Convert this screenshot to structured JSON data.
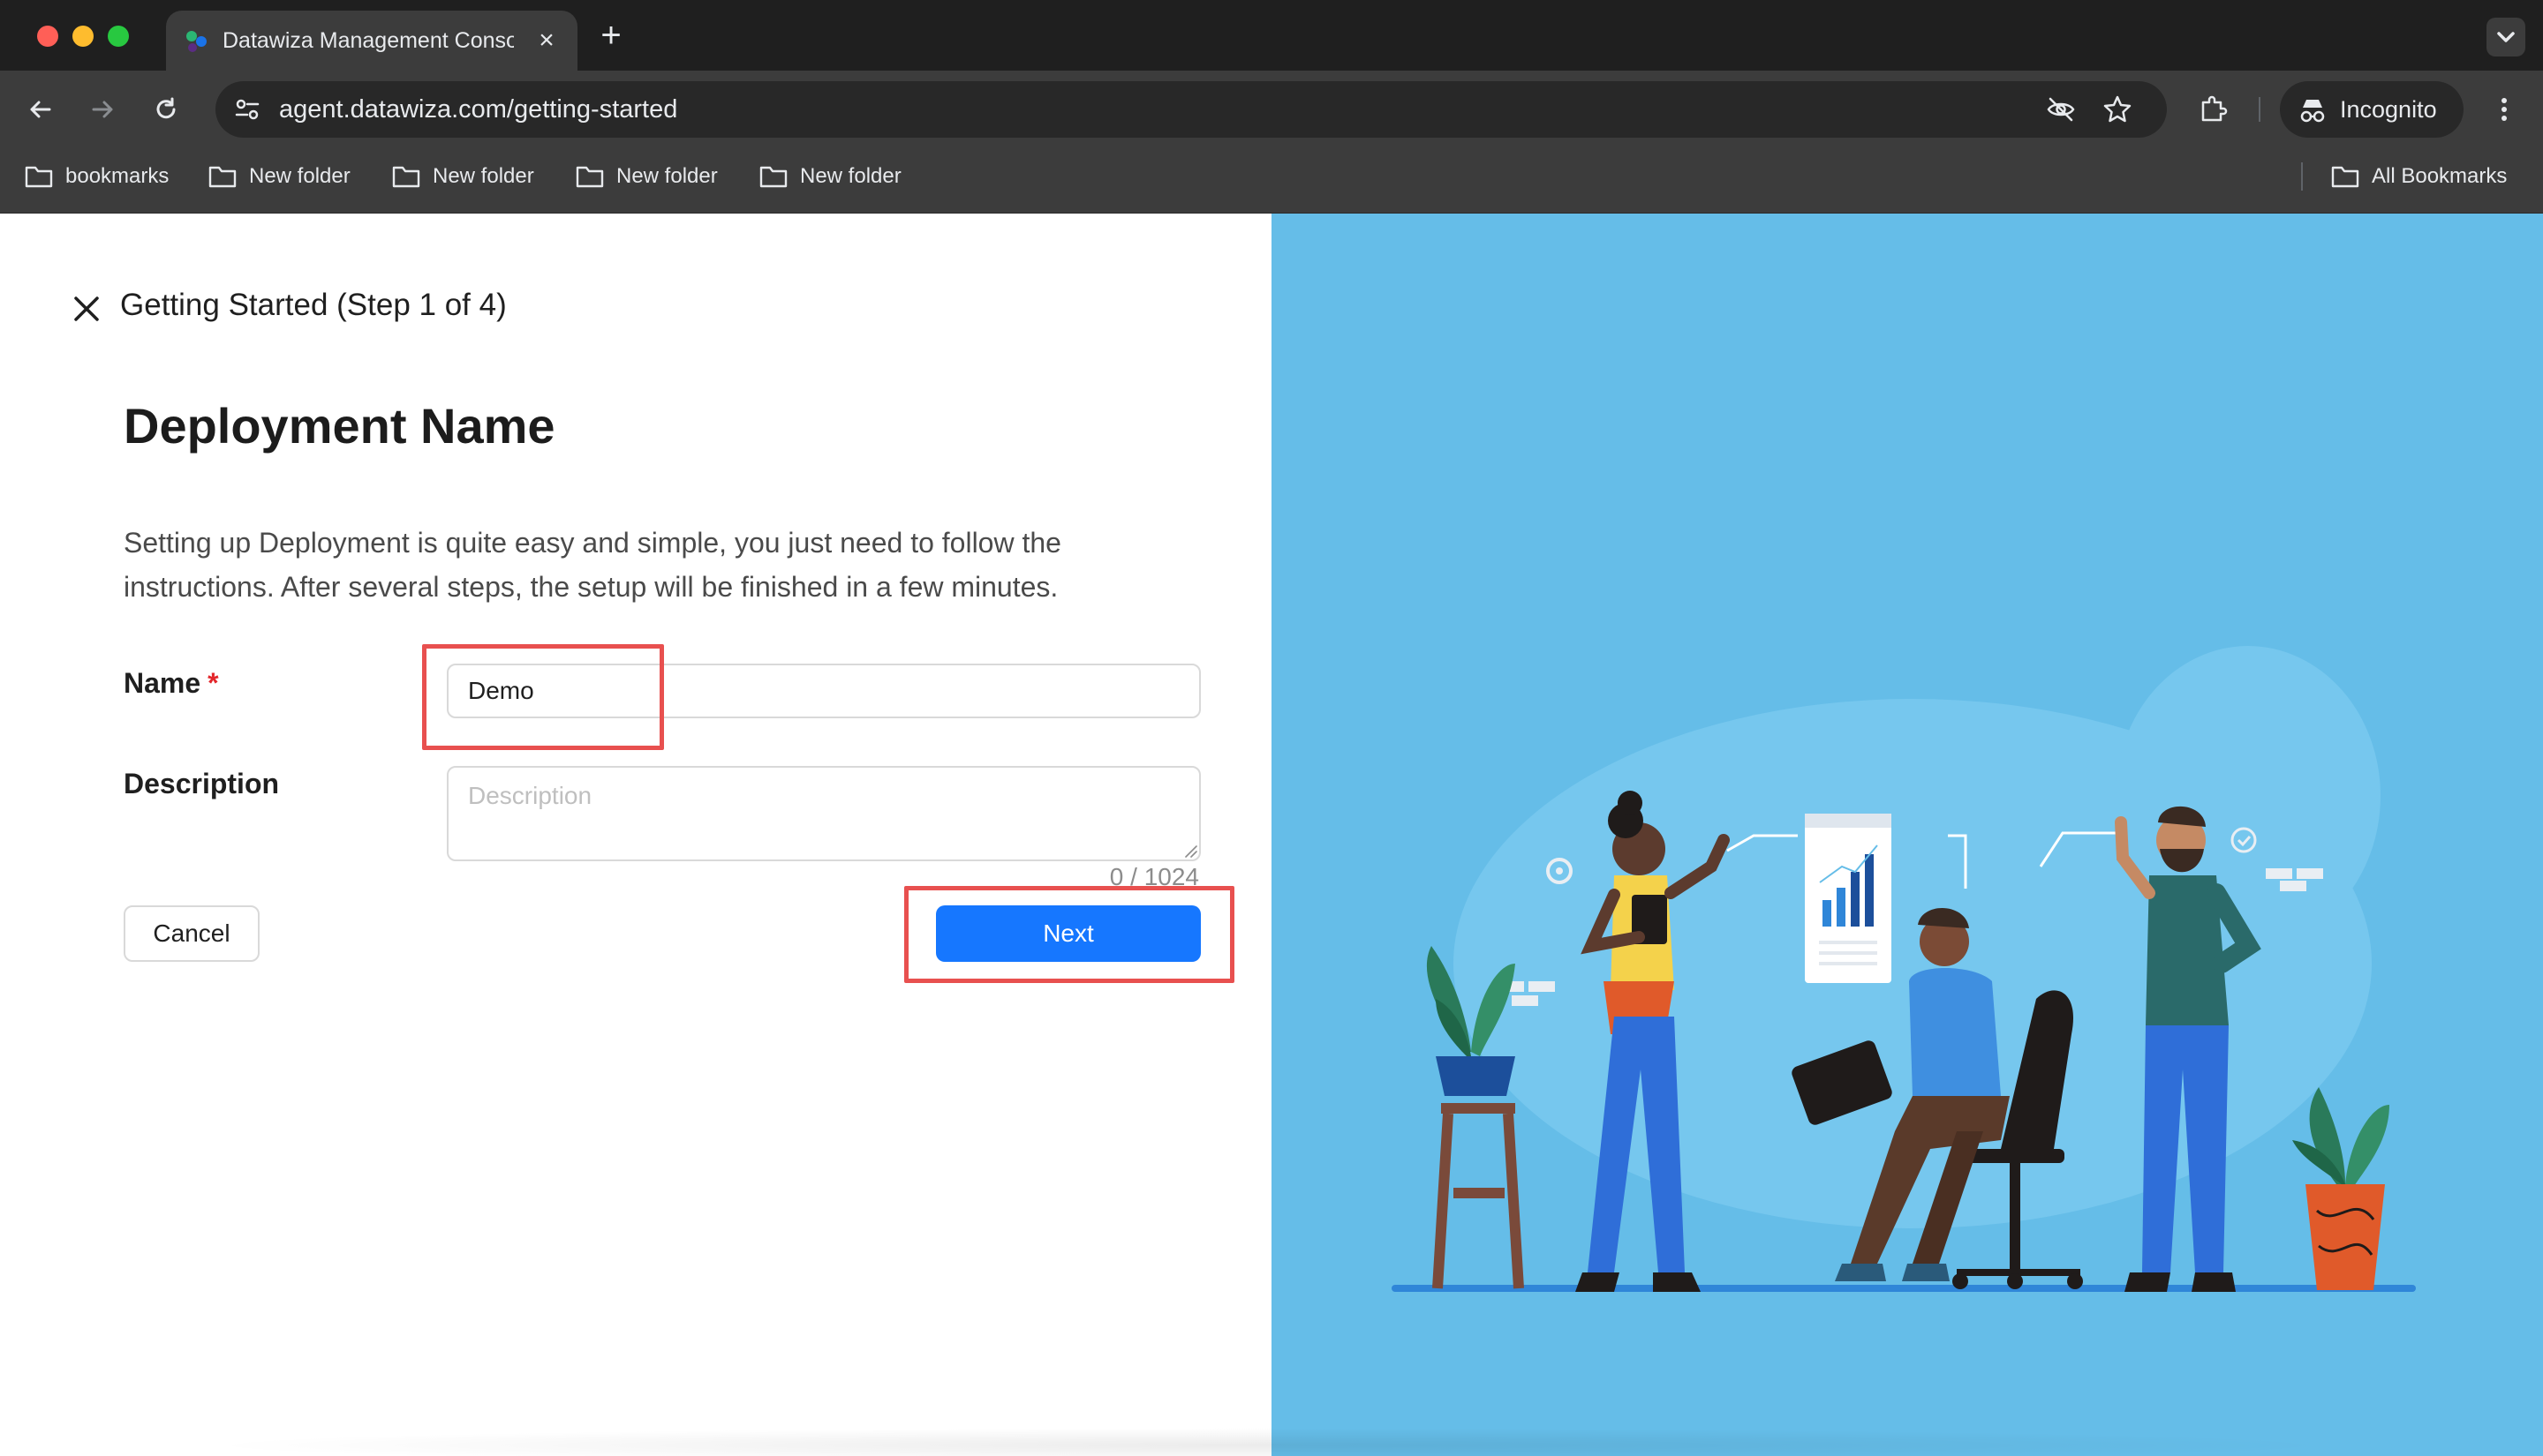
{
  "browser": {
    "tab_title": "Datawiza Management Conso",
    "url": "agent.datawiza.com/getting-started",
    "profile_label": "Incognito",
    "bookmarks": [
      "bookmarks",
      "New folder",
      "New folder",
      "New folder",
      "New folder"
    ],
    "all_bookmarks_label": "All Bookmarks"
  },
  "wizard": {
    "title": "Getting Started (Step 1 of 4)",
    "heading": "Deployment Name",
    "intro": "Setting up Deployment is quite easy and simple, you just need to follow the instructions. After several steps, the setup will be finished in a few minutes.",
    "name_label": "Name",
    "required_mark": "*",
    "name_value": "Demo",
    "description_label": "Description",
    "description_placeholder": "Description",
    "char_count": "0 / 1024",
    "cancel_label": "Cancel",
    "next_label": "Next"
  },
  "colors": {
    "primary": "#1677ff",
    "illustration_bg": "#65bde8",
    "annotation": "#e8504f"
  }
}
